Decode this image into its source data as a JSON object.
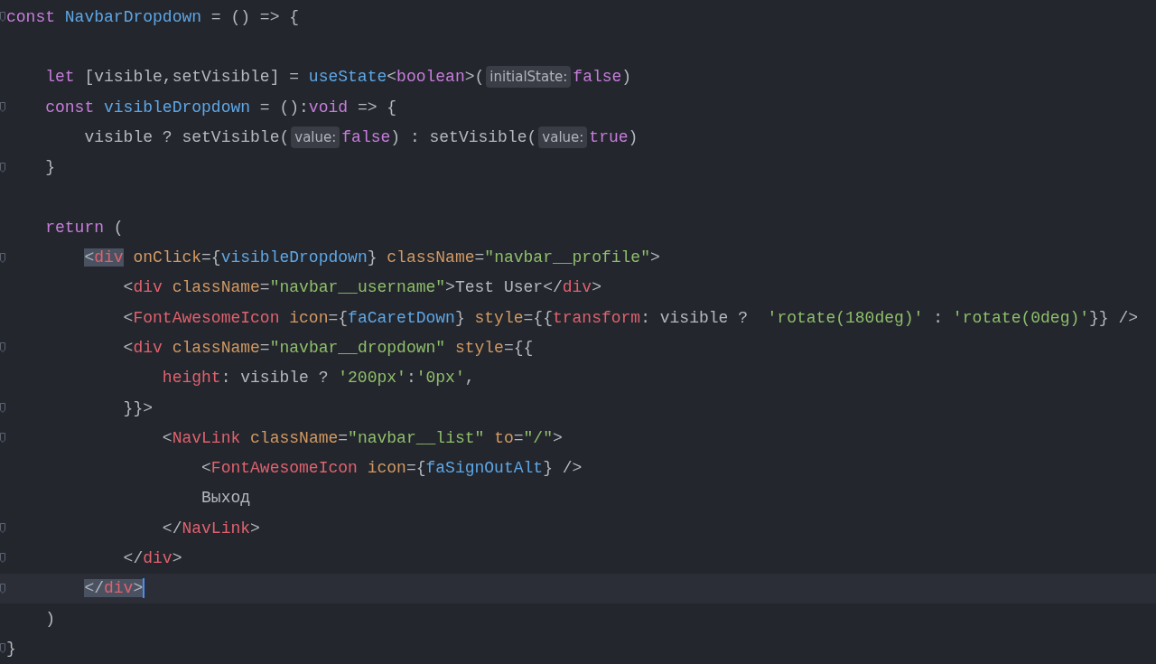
{
  "lines": [
    {
      "fold": true,
      "current": false,
      "segments": [
        {
          "kind": "code",
          "tokens": [
            {
              "kind": "kw",
              "t": "const"
            },
            {
              "kind": "fn",
              "t": " NavbarDropdown"
            },
            {
              "kind": "plain",
              "t": " = () => {"
            }
          ]
        }
      ],
      "children": [
        {
          "fold": false,
          "current": false
        },
        {
          "fold": false,
          "current": false,
          "segments": [
            {
              "kind": "code",
              "tokens": [
                {
                  "kind": "kw",
                  "t": "let"
                },
                {
                  "kind": "plain",
                  "t": " [visible,setVisible] ="
                },
                {
                  "kind": "fn",
                  "t": " useState"
                },
                {
                  "kind": "plain",
                  "t": "<"
                },
                {
                  "kind": "kw",
                  "t": "boolean"
                },
                {
                  "kind": "plain",
                  "t": ">("
                }
              ]
            },
            {
              "kind": "hint",
              "text": "initialState:"
            },
            {
              "kind": "code",
              "tokens": [
                {
                  "kind": "kw",
                  "t": "false"
                },
                {
                  "kind": "plain",
                  "t": ")"
                }
              ]
            }
          ]
        },
        {
          "fold": true,
          "current": false,
          "segments": [
            {
              "kind": "code",
              "tokens": [
                {
                  "kind": "kw",
                  "t": "const"
                },
                {
                  "kind": "fn",
                  "t": " visibleDropdown"
                },
                {
                  "kind": "plain",
                  "t": " = ():"
                },
                {
                  "kind": "kw",
                  "t": "void"
                },
                {
                  "kind": "plain",
                  "t": " => {"
                }
              ]
            }
          ],
          "children": [
            {
              "fold": false,
              "current": false,
              "segments": [
                {
                  "kind": "code",
                  "tokens": [
                    {
                      "kind": "plain",
                      "t": "visible ? setVisible("
                    }
                  ]
                },
                {
                  "kind": "hint",
                  "text": "value:"
                },
                {
                  "kind": "code",
                  "tokens": [
                    {
                      "kind": "kw",
                      "t": "false"
                    },
                    {
                      "kind": "plain",
                      "t": ") : setVisible("
                    }
                  ]
                },
                {
                  "kind": "hint",
                  "text": "value:"
                },
                {
                  "kind": "code",
                  "tokens": [
                    {
                      "kind": "kw",
                      "t": "true"
                    },
                    {
                      "kind": "plain",
                      "t": ")"
                    }
                  ]
                }
              ]
            }
          ]
        },
        {
          "fold": true,
          "current": false,
          "segments": [
            {
              "kind": "code",
              "tokens": [
                {
                  "kind": "plain",
                  "t": "}"
                }
              ]
            }
          ]
        },
        {
          "fold": false,
          "current": false
        },
        {
          "fold": false,
          "current": false,
          "segments": [
            {
              "kind": "code",
              "tokens": [
                {
                  "kind": "kw",
                  "t": "return"
                },
                {
                  "kind": "plain",
                  "t": " ("
                }
              ]
            }
          ],
          "children": [
            {
              "fold": true,
              "current": false,
              "segments": [
                {
                  "kind": "code",
                  "tokens": [
                    {
                      "kind": "punct-match",
                      "t": "<"
                    },
                    {
                      "kind": "tag-match",
                      "t": "div"
                    },
                    {
                      "kind": "attr",
                      "t": " onClick"
                    },
                    {
                      "kind": "plain",
                      "t": "={"
                    },
                    {
                      "kind": "fn",
                      "t": "visibleDropdown"
                    },
                    {
                      "kind": "plain",
                      "t": "}"
                    },
                    {
                      "kind": "attr",
                      "t": " className"
                    },
                    {
                      "kind": "plain",
                      "t": "="
                    },
                    {
                      "kind": "str",
                      "t": "\"navbar__profile\""
                    },
                    {
                      "kind": "plain",
                      "t": ">"
                    }
                  ]
                }
              ],
              "children": [
                {
                  "fold": false,
                  "current": false,
                  "segments": [
                    {
                      "kind": "code",
                      "tokens": [
                        {
                          "kind": "plain",
                          "t": "<"
                        },
                        {
                          "kind": "tag",
                          "t": "div"
                        },
                        {
                          "kind": "attr",
                          "t": " className"
                        },
                        {
                          "kind": "plain",
                          "t": "="
                        },
                        {
                          "kind": "str",
                          "t": "\"navbar__username\""
                        },
                        {
                          "kind": "plain",
                          "t": ">Test User</"
                        },
                        {
                          "kind": "tag",
                          "t": "div"
                        },
                        {
                          "kind": "plain",
                          "t": ">"
                        }
                      ]
                    }
                  ]
                },
                {
                  "fold": false,
                  "current": false,
                  "segments": [
                    {
                      "kind": "code",
                      "tokens": [
                        {
                          "kind": "plain",
                          "t": "<"
                        },
                        {
                          "kind": "tag",
                          "t": "FontAwesomeIcon"
                        },
                        {
                          "kind": "attr",
                          "t": " icon"
                        },
                        {
                          "kind": "plain",
                          "t": "={"
                        },
                        {
                          "kind": "fn",
                          "t": "faCaretDown"
                        },
                        {
                          "kind": "plain",
                          "t": "}"
                        },
                        {
                          "kind": "attr",
                          "t": " style"
                        },
                        {
                          "kind": "plain",
                          "t": "={{"
                        },
                        {
                          "kind": "prop",
                          "t": "transform"
                        },
                        {
                          "kind": "plain",
                          "t": ": visible ?"
                        },
                        {
                          "kind": "str",
                          "t": "  'rotate(180deg)'"
                        },
                        {
                          "kind": "plain",
                          "t": " :"
                        },
                        {
                          "kind": "str",
                          "t": " 'rotate(0deg)'"
                        },
                        {
                          "kind": "plain",
                          "t": "}} />"
                        }
                      ]
                    }
                  ]
                },
                {
                  "fold": true,
                  "current": false,
                  "segments": [
                    {
                      "kind": "code",
                      "tokens": [
                        {
                          "kind": "plain",
                          "t": "<"
                        },
                        {
                          "kind": "tag",
                          "t": "div"
                        },
                        {
                          "kind": "attr",
                          "t": " className"
                        },
                        {
                          "kind": "plain",
                          "t": "="
                        },
                        {
                          "kind": "str",
                          "t": "\"navbar__dropdown\""
                        },
                        {
                          "kind": "attr",
                          "t": " style"
                        },
                        {
                          "kind": "plain",
                          "t": "={{"
                        }
                      ]
                    }
                  ],
                  "children": [
                    {
                      "fold": false,
                      "current": false,
                      "segments": [
                        {
                          "kind": "code",
                          "tokens": [
                            {
                              "kind": "prop",
                              "t": "height"
                            },
                            {
                              "kind": "plain",
                              "t": ": visible ?"
                            },
                            {
                              "kind": "str",
                              "t": " '200px'"
                            },
                            {
                              "kind": "plain",
                              "t": ":"
                            },
                            {
                              "kind": "str",
                              "t": "'0px'"
                            },
                            {
                              "kind": "plain",
                              "t": ","
                            }
                          ]
                        }
                      ]
                    }
                  ]
                },
                {
                  "fold": true,
                  "current": false,
                  "segments": [
                    {
                      "kind": "code",
                      "tokens": [
                        {
                          "kind": "plain",
                          "t": "}}>"
                        }
                      ]
                    }
                  ],
                  "children": [
                    {
                      "fold": true,
                      "current": false,
                      "segments": [
                        {
                          "kind": "code",
                          "tokens": [
                            {
                              "kind": "plain",
                              "t": "<"
                            },
                            {
                              "kind": "tag",
                              "t": "NavLink"
                            },
                            {
                              "kind": "attr",
                              "t": " className"
                            },
                            {
                              "kind": "plain",
                              "t": "="
                            },
                            {
                              "kind": "str",
                              "t": "\"navbar__list\""
                            },
                            {
                              "kind": "attr",
                              "t": " to"
                            },
                            {
                              "kind": "plain",
                              "t": "="
                            },
                            {
                              "kind": "str",
                              "t": "\"/\""
                            },
                            {
                              "kind": "plain",
                              "t": ">"
                            }
                          ]
                        }
                      ],
                      "children": [
                        {
                          "fold": false,
                          "current": false,
                          "segments": [
                            {
                              "kind": "code",
                              "tokens": [
                                {
                                  "kind": "plain",
                                  "t": "<"
                                },
                                {
                                  "kind": "tag",
                                  "t": "FontAwesomeIcon"
                                },
                                {
                                  "kind": "attr",
                                  "t": " icon"
                                },
                                {
                                  "kind": "plain",
                                  "t": "={"
                                },
                                {
                                  "kind": "fn",
                                  "t": "faSignOutAlt"
                                },
                                {
                                  "kind": "plain",
                                  "t": "} />"
                                }
                              ]
                            }
                          ]
                        },
                        {
                          "fold": false,
                          "current": false,
                          "segments": [
                            {
                              "kind": "code",
                              "tokens": [
                                {
                                  "kind": "plain",
                                  "t": "Выход"
                                }
                              ]
                            }
                          ]
                        }
                      ]
                    },
                    {
                      "fold": true,
                      "current": false,
                      "segments": [
                        {
                          "kind": "code",
                          "tokens": [
                            {
                              "kind": "plain",
                              "t": "</"
                            },
                            {
                              "kind": "tag",
                              "t": "NavLink"
                            },
                            {
                              "kind": "plain",
                              "t": ">"
                            }
                          ]
                        }
                      ]
                    }
                  ]
                },
                {
                  "fold": true,
                  "current": false,
                  "segments": [
                    {
                      "kind": "code",
                      "tokens": [
                        {
                          "kind": "plain",
                          "t": "</"
                        },
                        {
                          "kind": "tag",
                          "t": "div"
                        },
                        {
                          "kind": "plain",
                          "t": ">"
                        }
                      ]
                    }
                  ]
                }
              ]
            },
            {
              "fold": true,
              "current": true,
              "segments": [
                {
                  "kind": "code",
                  "tokens": [
                    {
                      "kind": "punct-match",
                      "t": "</"
                    },
                    {
                      "kind": "tag-match",
                      "t": "div"
                    },
                    {
                      "kind": "punct-match",
                      "t": ">"
                    }
                  ]
                }
              ]
            }
          ]
        },
        {
          "fold": false,
          "current": false,
          "segments": [
            {
              "kind": "code",
              "tokens": [
                {
                  "kind": "plain",
                  "t": ")"
                }
              ]
            }
          ]
        }
      ]
    },
    {
      "fold": true,
      "current": false,
      "segments": [
        {
          "kind": "code",
          "tokens": [
            {
              "kind": "plain",
              "t": "}"
            }
          ]
        }
      ]
    }
  ]
}
